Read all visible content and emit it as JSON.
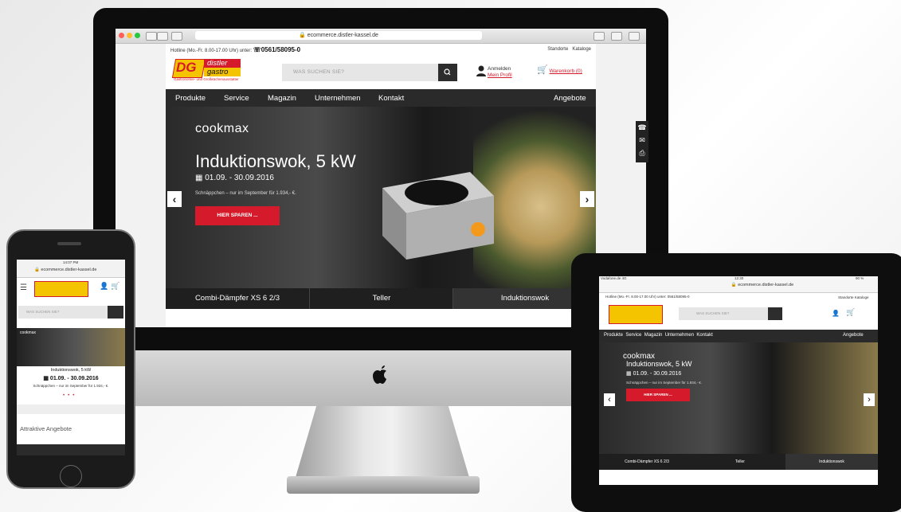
{
  "desktop": {
    "url": "ecommerce.distler-kassel.de",
    "hotline_label": "Hotline (Mo.-Fr. 8.00-17.00 Uhr) unter:",
    "hotline_number": "0561/58095-0",
    "top_links": [
      "Standorte",
      "Kataloge"
    ],
    "logo": {
      "letters": "DG",
      "line1": "distler",
      "line2": "gastro",
      "tagline": "Gastronomie- und Großküchenausstatter"
    },
    "search": {
      "placeholder": "WAS SUCHEN SIE?"
    },
    "account": {
      "line1": "Anmelden",
      "line2": "Mein Profil"
    },
    "cart": {
      "label": "Warenkorb (0)",
      "count": "0"
    },
    "nav": [
      "Produkte",
      "Service",
      "Magazin",
      "Unternehmen",
      "Kontakt"
    ],
    "nav_right": "Angebote",
    "hero": {
      "brand": "cookmax",
      "title": "Induktionswok, 5 kW",
      "date": "01.09. - 30.09.2016",
      "subtitle": "Schnäppchen – nur im September für 1.934,- €.",
      "cta": "HIER SPAREN ..."
    },
    "tabs": [
      "Combi-Dämpfer XS 6 2/3",
      "Teller",
      "Induktionswok"
    ]
  },
  "phone": {
    "time": "14:07 PM",
    "url": "ecommerce.distler-kassel.de",
    "search": "WAS SUCHEN SIE?",
    "brand": "cookmax",
    "title": "Induktionswok, 5 kW",
    "date": "01.09. - 30.09.2016",
    "subtitle": "Schnäppchen – nur im September für 1.934,- €.",
    "section": "Attraktive Angebote"
  },
  "tablet": {
    "carrier": "Vodafone.de",
    "network": "4G",
    "time": "12:30",
    "battery": "90 %",
    "url": "ecommerce.distler-kassel.de",
    "hotline": "Hotline (Mo.-Fr. 8.00-17.00 Uhr) unter: 0561/58095-0",
    "top_links": "Standorte  Kataloge",
    "search": "WAS SUCHEN SIE?",
    "nav": "Produkte  Service  Magazin  Unternehmen  Kontakt",
    "nav_right": "Angebote",
    "brand": "cookmax",
    "title": "Induktionswok, 5 kW",
    "date": "01.09. - 30.09.2016",
    "subtitle": "Schnäppchen – nur im September für 1.934,- €.",
    "cta": "HIER SPAREN ...",
    "tabs": [
      "Combi-Dämpfer XS 6 2/3",
      "Teller",
      "Induktionswok"
    ]
  },
  "colors": {
    "accent": "#d51a2b",
    "logo_yellow": "#f5c400",
    "nav_bg": "#2a2a2a"
  }
}
